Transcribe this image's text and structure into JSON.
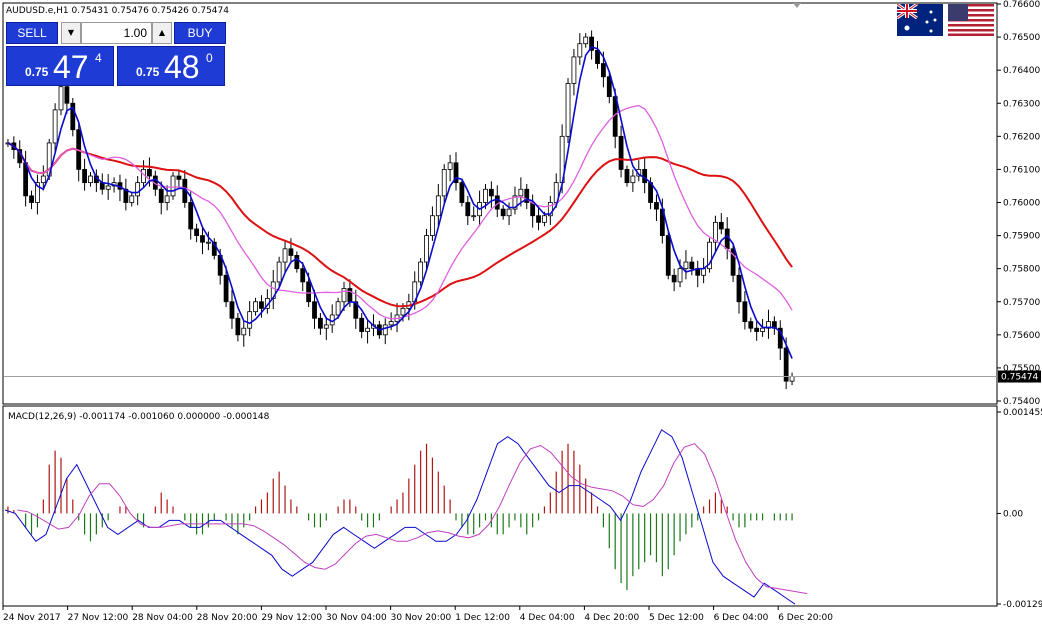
{
  "header": {
    "symbol_line": "AUDUSD.e,H1  0.75431 0.75476 0.75426 0.75474"
  },
  "trade_panel": {
    "sell_label": "SELL",
    "buy_label": "BUY",
    "lot_value": "1.00",
    "down_arrow": "▼",
    "up_arrow": "▲",
    "sell_quote": {
      "prefix": "0.75",
      "big": "47",
      "sup": "4"
    },
    "buy_quote": {
      "prefix": "0.75",
      "big": "48",
      "sup": "0"
    }
  },
  "flags": [
    {
      "name": "australia-flag-icon"
    },
    {
      "name": "usa-flag-icon"
    }
  ],
  "colors": {
    "candle": "#000000",
    "ma_fast": "#0a0acc",
    "ma_slow": "#e060e0",
    "ma_long": "#dd1111",
    "macd_hist_pos": "#b01515",
    "macd_hist_neg": "#1a7a1a",
    "macd_line": "#0a0acc",
    "signal_line": "#c040c0",
    "grid_axis": "#000000",
    "current_price_line": "#a0a0a0"
  },
  "chart_data": [
    {
      "type": "candlestick",
      "title": "AUDUSD.e,H1",
      "ylim": [
        0.754,
        0.766
      ],
      "y_ticks": [
        "0.76600",
        "0.76500",
        "0.76400",
        "0.76300",
        "0.76200",
        "0.76100",
        "0.76000",
        "0.75900",
        "0.75800",
        "0.75700",
        "0.75600",
        "0.75500",
        "0.75400"
      ],
      "current_price_label": "0.75474",
      "current_price": 0.75474,
      "x_labels": [
        "24 Nov 2017",
        "27 Nov 12:00",
        "28 Nov 04:00",
        "28 Nov 20:00",
        "29 Nov 12:00",
        "30 Nov 04:00",
        "30 Nov 20:00",
        "1 Dec 12:00",
        "4 Dec 04:00",
        "4 Dec 20:00",
        "5 Dec 12:00",
        "6 Dec 04:00",
        "6 Dec 20:00"
      ],
      "close": [
        0.7618,
        0.7616,
        0.7612,
        0.7602,
        0.76,
        0.7606,
        0.7608,
        0.7618,
        0.7628,
        0.7635,
        0.763,
        0.7622,
        0.761,
        0.7606,
        0.7608,
        0.7606,
        0.7604,
        0.7605,
        0.7606,
        0.7604,
        0.76,
        0.7602,
        0.7606,
        0.761,
        0.7608,
        0.7604,
        0.76,
        0.7602,
        0.7608,
        0.7607,
        0.76,
        0.7592,
        0.759,
        0.7588,
        0.7588,
        0.7584,
        0.7578,
        0.757,
        0.7565,
        0.756,
        0.7562,
        0.7567,
        0.757,
        0.7568,
        0.7571,
        0.7576,
        0.7582,
        0.7586,
        0.7584,
        0.758,
        0.7576,
        0.757,
        0.7565,
        0.7562,
        0.7563,
        0.7566,
        0.757,
        0.7574,
        0.757,
        0.7565,
        0.7561,
        0.7562,
        0.7563,
        0.756,
        0.7563,
        0.7564,
        0.7566,
        0.7568,
        0.757,
        0.7576,
        0.7582,
        0.759,
        0.7596,
        0.7602,
        0.761,
        0.7612,
        0.7606,
        0.76,
        0.7596,
        0.7596,
        0.76,
        0.7604,
        0.7602,
        0.7598,
        0.7596,
        0.7598,
        0.7602,
        0.7604,
        0.76,
        0.7596,
        0.7594,
        0.7596,
        0.76,
        0.7606,
        0.762,
        0.7636,
        0.7644,
        0.7648,
        0.765,
        0.7646,
        0.7642,
        0.7638,
        0.7632,
        0.762,
        0.761,
        0.7606,
        0.7608,
        0.761,
        0.7606,
        0.76,
        0.7598,
        0.759,
        0.7578,
        0.7576,
        0.758,
        0.7582,
        0.758,
        0.7578,
        0.758,
        0.7588,
        0.7594,
        0.7592,
        0.7586,
        0.7578,
        0.757,
        0.7564,
        0.7562,
        0.7561,
        0.7562,
        0.7564,
        0.7562,
        0.7556,
        0.7546,
        0.75474
      ],
      "series": [
        {
          "values_key": "close"
        }
      ]
    },
    {
      "type": "macd",
      "label": "MACD(12,26,9) -0.001174 -0.001060 0.000000 -0.000148",
      "y_ticks": [
        "0.001455",
        "0.00",
        "-0.001299"
      ],
      "ylim": [
        -0.001299,
        0.001455
      ],
      "histogram": [
        0.0001,
        5e-05,
        0.0,
        -0.0002,
        -0.0003,
        -0.0002,
        0.0002,
        0.0007,
        0.0009,
        0.0008,
        0.0005,
        0.0002,
        -0.0001,
        -0.0003,
        -0.0004,
        -0.0003,
        -0.0002,
        -0.0001,
        0.0,
        0.0001,
        0.0001,
        0.0,
        -0.0001,
        -0.0002,
        0.0,
        0.0001,
        0.0003,
        0.0002,
        0.0001,
        0.0,
        -0.0001,
        -0.0002,
        -0.0003,
        -0.0003,
        -0.0002,
        -0.0001,
        0.0,
        -0.0001,
        -0.0002,
        -0.0003,
        -0.0002,
        -0.0001,
        0.0001,
        0.0002,
        0.0003,
        0.0005,
        0.0006,
        0.0004,
        0.0002,
        0.0001,
        0.0,
        -0.0001,
        -0.0002,
        -0.0002,
        -0.0001,
        0.0,
        0.0001,
        0.0002,
        0.0002,
        0.0001,
        -0.0001,
        -0.0002,
        -0.0002,
        -0.0001,
        0.0,
        0.0001,
        0.0002,
        0.0003,
        0.0005,
        0.0007,
        0.0009,
        0.001,
        0.0008,
        0.0006,
        0.0004,
        0.0002,
        -0.0001,
        -0.0002,
        -0.0003,
        -0.0003,
        -0.0002,
        -0.0001,
        -0.0002,
        -0.0003,
        -0.0003,
        -0.0002,
        -0.0001,
        -0.0002,
        -0.0003,
        -0.0002,
        -0.0001,
        0.0001,
        0.0003,
        0.0006,
        0.0009,
        0.001,
        0.0009,
        0.0007,
        0.0005,
        0.0003,
        0.0001,
        -0.0002,
        -0.0005,
        -0.0008,
        -0.001,
        -0.0011,
        -0.0009,
        -0.0008,
        -0.0007,
        -0.0006,
        -0.0007,
        -0.0009,
        -0.0008,
        -0.0006,
        -0.0004,
        -0.0003,
        -0.0002,
        -0.0001,
        0.0001,
        0.0002,
        0.0003,
        0.0002,
        0.0001,
        -0.0001,
        -0.0002,
        -0.0002,
        -0.0001,
        -0.0001,
        -0.0001,
        0.0,
        -0.0001,
        -0.0001,
        -0.0001,
        -0.0001
      ],
      "macd": [
        5e-05,
        0.0,
        -0.0002,
        -0.0004,
        -0.0003,
        0.0001,
        0.0005,
        0.0007,
        0.0004,
        0.0001,
        -0.0002,
        -0.0003,
        -0.0002,
        -0.0001,
        -0.0002,
        -0.0002,
        -0.0001,
        -0.0001,
        -0.0002,
        -0.0002,
        -0.0001,
        -0.0001,
        -0.0002,
        -0.0003,
        -0.0004,
        -0.0005,
        -0.0006,
        -0.0008,
        -0.0009,
        -0.0008,
        -0.0007,
        -0.0005,
        -0.0003,
        -0.0002,
        -0.0003,
        -0.0004,
        -0.0005,
        -0.0004,
        -0.0003,
        -0.0002,
        -0.0002,
        -0.0003,
        -0.0004,
        -0.0004,
        -0.0003,
        -0.0001,
        0.0002,
        0.0006,
        0.001,
        0.0011,
        0.001,
        0.0008,
        0.0006,
        0.0004,
        0.0003,
        0.0004,
        0.0004,
        0.0003,
        0.0002,
        0.0001,
        -0.0001,
        0.0002,
        0.0006,
        0.0009,
        0.0012,
        0.0011,
        0.0008,
        0.0003,
        -0.0002,
        -0.0007,
        -0.0009,
        -0.001,
        -0.0011,
        -0.0012,
        -0.001,
        -0.0011,
        -0.0012,
        -0.0013
      ]
    }
  ]
}
